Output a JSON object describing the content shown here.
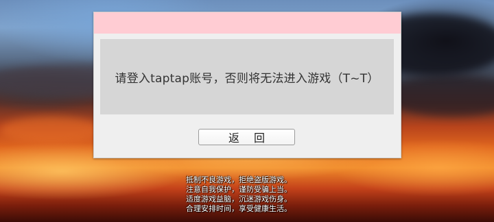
{
  "dialog": {
    "message": "请登入taptap账号，否则将无法进入游戏（T~T）",
    "back_button_label": "返 回"
  },
  "health_advisory": {
    "lines": [
      "抵制不良游戏，拒绝盗版游戏。",
      "注意自我保护，谨防受骗上当。",
      "适度游戏益脑，沉迷游戏伤身。",
      "合理安排时间，享受健康生活。"
    ]
  },
  "colors": {
    "titlebar": "#ffccd3",
    "dialog_bg": "#efefef",
    "message_panel_bg": "#d6d6d6"
  }
}
